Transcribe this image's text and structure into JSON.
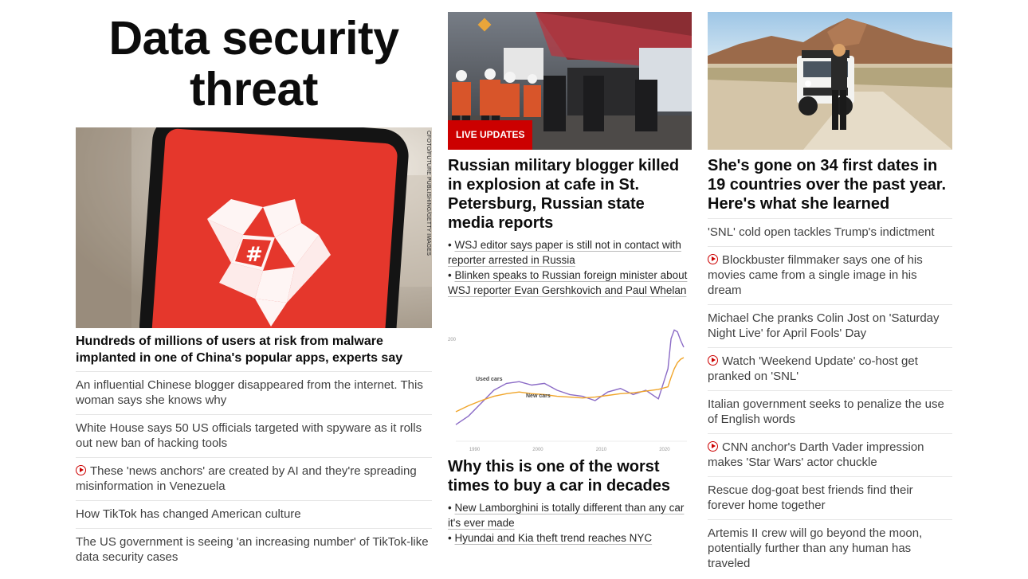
{
  "column1": {
    "title": "Data security threat",
    "hero_credit": "CFOTO/FUTURE PUBLISHING/GETTY IMAGES",
    "main_headline": "Hundreds of millions of users at risk from malware implanted in one of China's popular apps, experts say",
    "links": [
      {
        "text": "An influential Chinese blogger disappeared from the internet. This woman says she knows why",
        "video": false
      },
      {
        "text": "White House says 50 US officials targeted with spyware as it rolls out new ban of hacking tools",
        "video": false
      },
      {
        "text": "These 'news anchors' are created by AI and they're spreading misinformation in Venezuela",
        "video": true
      },
      {
        "text": "How TikTok has changed American culture",
        "video": false
      },
      {
        "text": "The US government is seeing 'an increasing number' of TikTok-like data security cases",
        "video": false
      }
    ]
  },
  "column2": {
    "live_badge": "LIVE UPDATES",
    "headline1": "Russian military blogger killed in explosion at cafe in St. Petersburg, Russian state media reports",
    "bullets1": [
      "WSJ editor says paper is still not in contact with reporter arrested in Russia",
      "Blinken speaks to Russian foreign minister about WSJ reporter Evan Gershkovich and Paul Whelan"
    ],
    "headline2": "Why this is one of the worst times to buy a car in decades",
    "bullets2": [
      "New Lamborghini is totally different than any car it's ever made",
      "Hyundai and Kia theft trend reaches NYC"
    ]
  },
  "column3": {
    "headline": "She's gone on 34 first dates in 19 countries over the past year. Here's what she learned",
    "links": [
      {
        "text": "'SNL' cold open tackles Trump's indictment",
        "video": false
      },
      {
        "text": "Blockbuster filmmaker says one of his movies came from a single image in his dream",
        "video": true
      },
      {
        "text": "Michael Che pranks Colin Jost on 'Saturday Night Live' for April Fools' Day",
        "video": false
      },
      {
        "text": "Watch 'Weekend Update' co-host get pranked on 'SNL'",
        "video": true
      },
      {
        "text": "Italian government seeks to penalize the use of English words",
        "video": false
      },
      {
        "text": "CNN anchor's Darth Vader impression makes 'Star Wars' actor chuckle",
        "video": true
      },
      {
        "text": "Rescue dog-goat best friends find their forever home together",
        "video": false
      },
      {
        "text": "Artemis II crew will go beyond the moon, potentially further than any human has traveled",
        "video": false
      }
    ]
  },
  "chart_data": {
    "type": "line",
    "series": [
      {
        "name": "Used cars",
        "color": "#8b6bc6",
        "x": [
          1987,
          1989,
          1991,
          1993,
          1995,
          1997,
          1999,
          2001,
          2003,
          2005,
          2007,
          2009,
          2011,
          2013,
          2015,
          2017,
          2019,
          2020.5,
          2021,
          2021.5,
          2022,
          2022.5,
          2023
        ],
        "values": [
          100,
          110,
          125,
          140,
          148,
          150,
          146,
          148,
          140,
          135,
          133,
          128,
          138,
          142,
          135,
          140,
          130,
          165,
          200,
          210,
          208,
          198,
          190
        ]
      },
      {
        "name": "New cars",
        "color": "#f0a52a",
        "x": [
          1987,
          1989,
          1991,
          1993,
          1995,
          1997,
          1999,
          2001,
          2003,
          2005,
          2007,
          2009,
          2011,
          2013,
          2015,
          2017,
          2019,
          2020.5,
          2021,
          2021.5,
          2022,
          2022.5,
          2023
        ],
        "values": [
          115,
          122,
          128,
          133,
          136,
          138,
          136,
          135,
          133,
          132,
          131,
          132,
          134,
          136,
          137,
          139,
          141,
          144,
          155,
          165,
          172,
          176,
          178
        ]
      }
    ],
    "x_ticks": [
      "1990",
      "2000",
      "2010",
      "2020"
    ],
    "y_ticks": [
      "200"
    ]
  }
}
